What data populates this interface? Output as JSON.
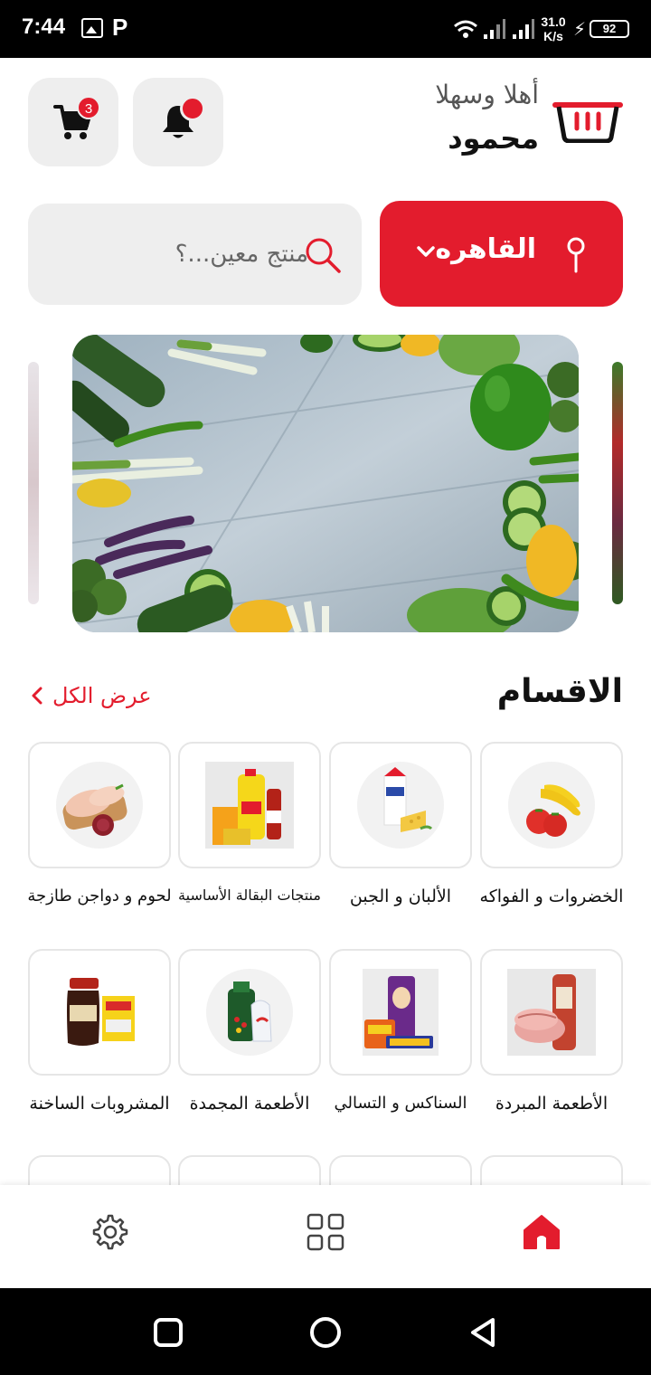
{
  "status_bar": {
    "time": "7:44",
    "p_icon": "P",
    "speed_value": "31.0",
    "speed_unit": "K/s",
    "battery": "92"
  },
  "header": {
    "greeting": "أهلا وسهلا",
    "username": "محمود",
    "cart_count": "3"
  },
  "location": {
    "city": "القاهره"
  },
  "search": {
    "placeholder": "منتج معين...؟"
  },
  "categories": {
    "title": "الاقسام",
    "view_all": "عرض الكل",
    "items": [
      {
        "label": "الخضروات و الفواكه",
        "icon": "fruits-vegetables-thumb"
      },
      {
        "label": "الألبان و الجبن",
        "icon": "dairy-cheese-thumb"
      },
      {
        "label": "منتجات البقالة الأساسية",
        "icon": "grocery-basics-thumb"
      },
      {
        "label": "لحوم و دواجن طازجة",
        "icon": "fresh-meat-poultry-thumb"
      },
      {
        "label": "الأطعمة المبردة",
        "icon": "chilled-food-thumb"
      },
      {
        "label": "السناكس و التسالي",
        "icon": "snacks-thumb"
      },
      {
        "label": "الأطعمة المجمدة",
        "icon": "frozen-food-thumb"
      },
      {
        "label": "المشروبات الساخنة",
        "icon": "hot-drinks-thumb"
      }
    ]
  },
  "colors": {
    "accent": "#e31c2d",
    "tile_bg": "#eeeeee"
  }
}
